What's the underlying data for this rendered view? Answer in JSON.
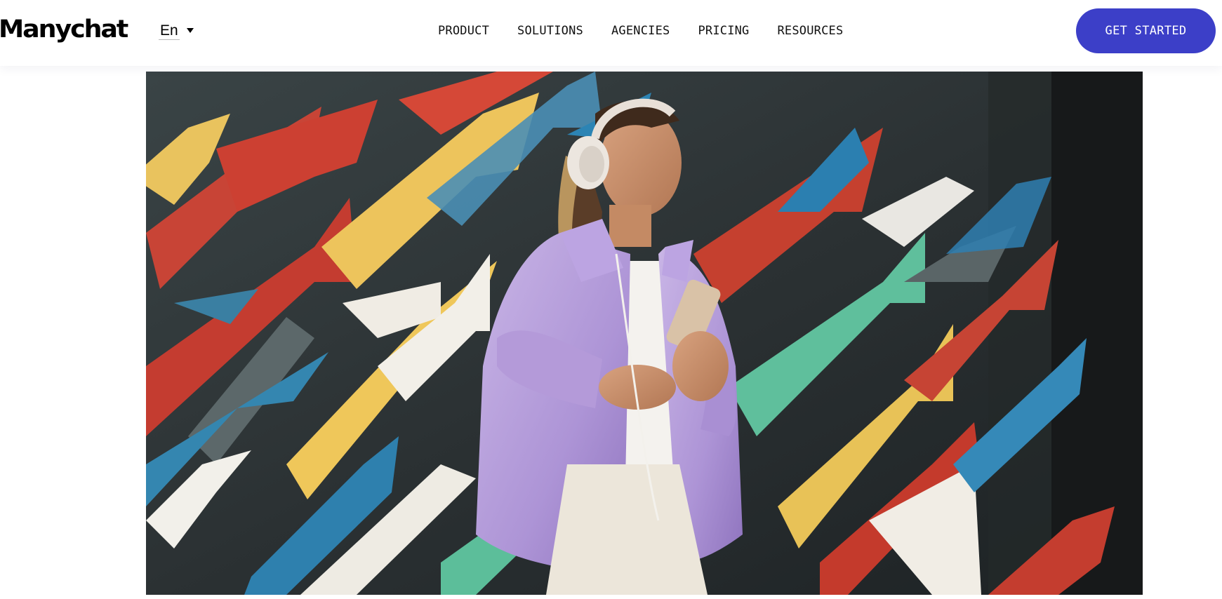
{
  "header": {
    "logo_text": "Manychat",
    "language": "En",
    "nav_items": [
      "PRODUCT",
      "SOLUTIONS",
      "AGENCIES",
      "PRICING",
      "RESOURCES"
    ],
    "cta_label": "GET STARTED"
  },
  "hero": {
    "image": "woman-with-headphones-and-phone-graffiti-arrows-photo"
  },
  "colors": {
    "accent": "#3c3fc8",
    "background": "#ffffff",
    "text": "#111111"
  }
}
